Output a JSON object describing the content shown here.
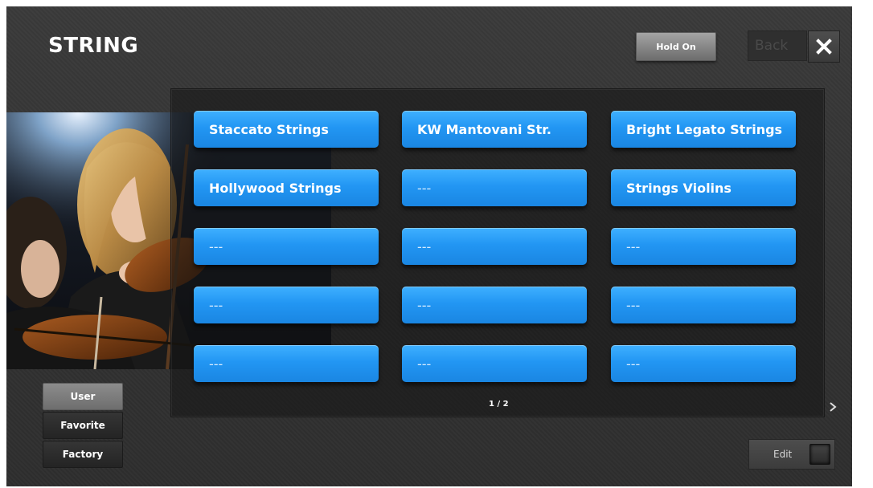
{
  "header": {
    "title": "STRING",
    "hold_label": "Hold On",
    "back_label": "Back"
  },
  "sounds": [
    {
      "label": "Staccato Strings"
    },
    {
      "label": "KW Mantovani Str."
    },
    {
      "label": "Bright Legato Strings"
    },
    {
      "label": "Hollywood Strings"
    },
    {
      "label": "---"
    },
    {
      "label": "Strings Violins"
    },
    {
      "label": "---"
    },
    {
      "label": "---"
    },
    {
      "label": "---"
    },
    {
      "label": "---"
    },
    {
      "label": "---"
    },
    {
      "label": "---"
    },
    {
      "label": "---"
    },
    {
      "label": "---"
    },
    {
      "label": "---"
    }
  ],
  "pager": {
    "text": "1 / 2"
  },
  "categories": [
    {
      "label": "User",
      "active": true
    },
    {
      "label": "Favorite",
      "active": false
    },
    {
      "label": "Factory",
      "active": false
    }
  ],
  "footer": {
    "edit_label": "Edit"
  },
  "colors": {
    "button_blue": "#2296f3",
    "background": "#333333",
    "active_category": "#7a7a7a"
  },
  "icons": {
    "close": "close-icon",
    "next": "next-page-icon",
    "edit_led": "edit-led-indicator"
  }
}
